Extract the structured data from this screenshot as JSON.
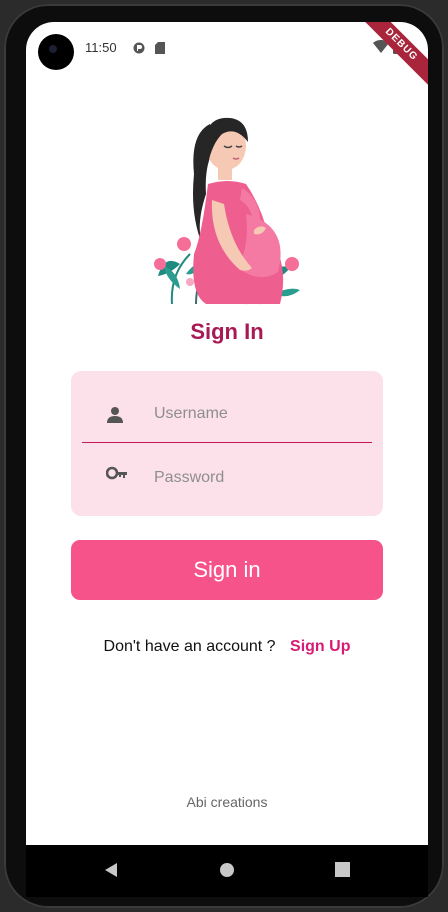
{
  "status_bar": {
    "time": "11:50",
    "debug_banner": "DEBUG"
  },
  "page": {
    "title": "Sign In"
  },
  "form": {
    "username_placeholder": "Username",
    "password_placeholder": "Password",
    "username_icon": "person-icon",
    "password_icon": "key-icon"
  },
  "buttons": {
    "signin_label": "Sign in"
  },
  "signup": {
    "prompt": "Don't have an account ?",
    "link_label": "Sign Up"
  },
  "footer": {
    "credit": "Abi creations"
  },
  "colors": {
    "primary": "#f6538a",
    "title": "#a81a56",
    "card_bg": "#fde1ea",
    "link": "#d81b75"
  }
}
